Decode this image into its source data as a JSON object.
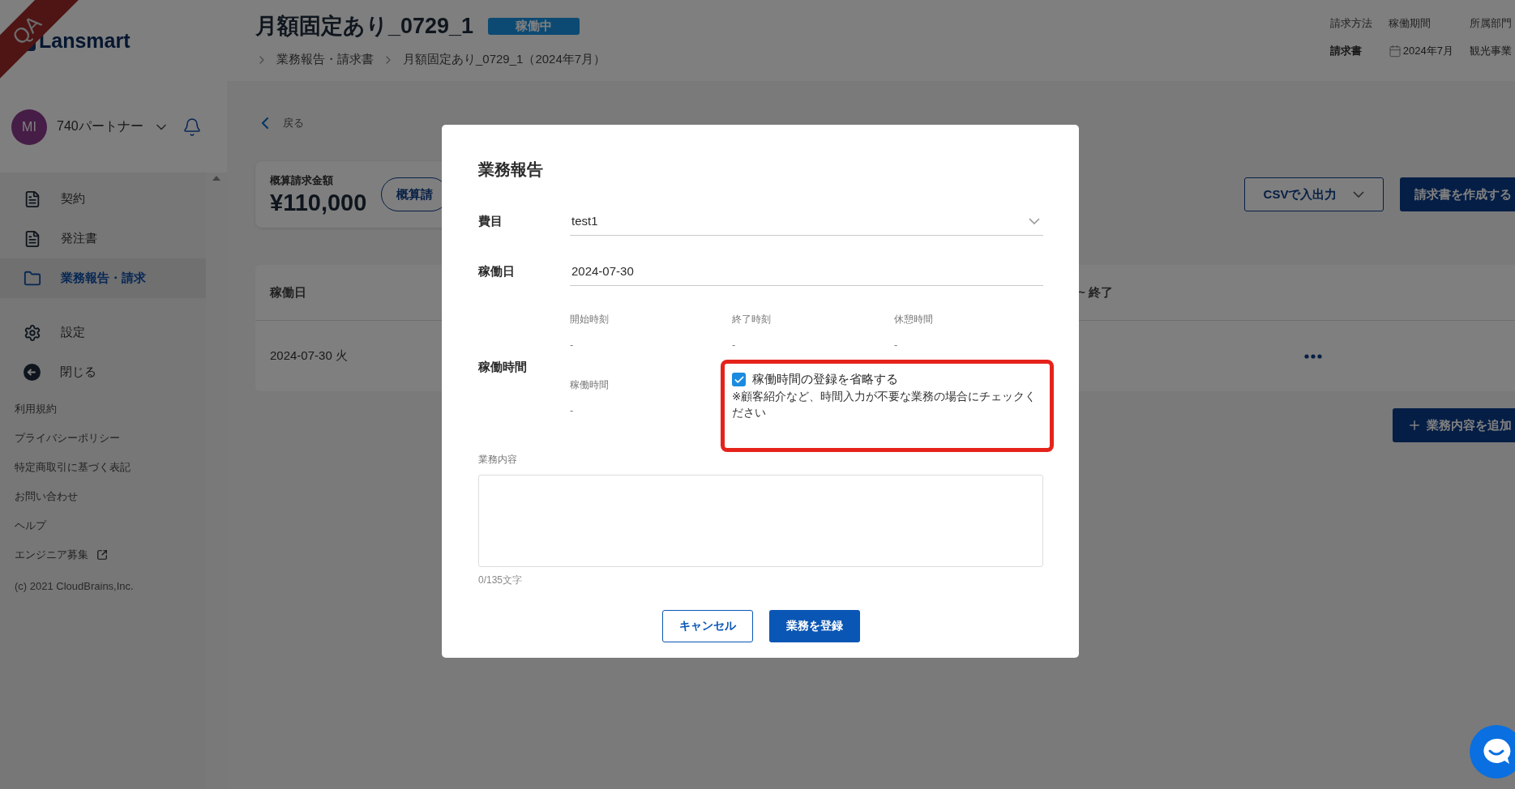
{
  "env_badge": "QA",
  "logo": "Lansmart",
  "user": {
    "initials": "MI",
    "name": "740パートナー"
  },
  "nav": [
    {
      "label": "契約",
      "kind": "document",
      "selected": false
    },
    {
      "label": "発注書",
      "kind": "document",
      "selected": false
    },
    {
      "label": "業務報告・請求",
      "kind": "folder",
      "selected": true
    }
  ],
  "nav_secondary": [
    {
      "label": "設定",
      "kind": "gear",
      "selected": false
    },
    {
      "label": "閉じる",
      "kind": "back",
      "selected": false
    }
  ],
  "footer_links": [
    {
      "label": "利用規約",
      "external": false
    },
    {
      "label": "プライバシーポリシー",
      "external": false
    },
    {
      "label": "特定商取引に基づく表記",
      "external": false
    },
    {
      "label": "お問い合わせ",
      "external": false
    },
    {
      "label": "ヘルプ",
      "external": false
    },
    {
      "label": "エンジニア募集",
      "external": true
    }
  ],
  "copyright": "(c) 2021 CloudBrains,Inc.",
  "header": {
    "title": "月額固定あり_0729_1",
    "status": "稼働中",
    "breadcrumb": [
      "業務報告・請求書",
      "月額固定あり_0729_1（2024年7月）"
    ],
    "meta": [
      {
        "label": "請求方法",
        "value": "請求書",
        "kind": "text"
      },
      {
        "label": "稼働期間",
        "value": "2024年7月",
        "kind": "date"
      },
      {
        "label": "所属部門",
        "value": "観光事業",
        "kind": "text"
      }
    ]
  },
  "back": "戻る",
  "summary": {
    "label": "概算請求金額",
    "amount": "¥110,000",
    "button": "概算請"
  },
  "actions": {
    "csv": "CSVで入出力",
    "create": "請求書を作成する"
  },
  "table": {
    "columns": [
      {
        "label": "稼働日"
      },
      {
        "label": "~ 終了"
      }
    ],
    "rows": [
      {
        "date": "2024-07-30 火"
      }
    ]
  },
  "add_button": "業務内容を追加",
  "modal": {
    "title": "業務報告",
    "fields": [
      {
        "label": "費目",
        "value": "test1",
        "kind": "select"
      },
      {
        "label": "稼働日",
        "value": "2024-07-30",
        "kind": "text"
      }
    ],
    "work_time": {
      "label": "稼働時間",
      "items": [
        {
          "label": "開始時刻",
          "value": "-"
        },
        {
          "label": "終了時刻",
          "value": "-"
        },
        {
          "label": "休憩時間",
          "value": "-"
        },
        {
          "label": "稼働時間",
          "value": "-"
        }
      ],
      "skip": {
        "label": "稼働時間の登録を省略する",
        "checked": true,
        "note": "※顧客紹介など、時間入力が不要な業務の場合にチェックください",
        "highlighted": true
      }
    },
    "content": {
      "label": "業務内容",
      "counter": "0/135文字"
    },
    "buttons": [
      {
        "label": "キャンセル",
        "kind": "secondary"
      },
      {
        "label": "業務を登録",
        "kind": "primary"
      }
    ]
  }
}
